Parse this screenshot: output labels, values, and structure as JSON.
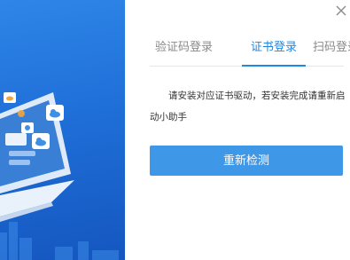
{
  "dialog": {
    "tabs": [
      {
        "label": "验证码登录",
        "active": false
      },
      {
        "label": "证书登录",
        "active": true
      },
      {
        "label": "扫码登录",
        "active": false
      }
    ],
    "message": "请安装对应证书驱动，若安装完成请重新启动小助手",
    "redetect_label": "重新检测",
    "close_icon": "close-icon"
  },
  "colors": {
    "accent": "#1e88e5",
    "button": "#3f97e8",
    "left_panel": "#1f6fd8"
  }
}
